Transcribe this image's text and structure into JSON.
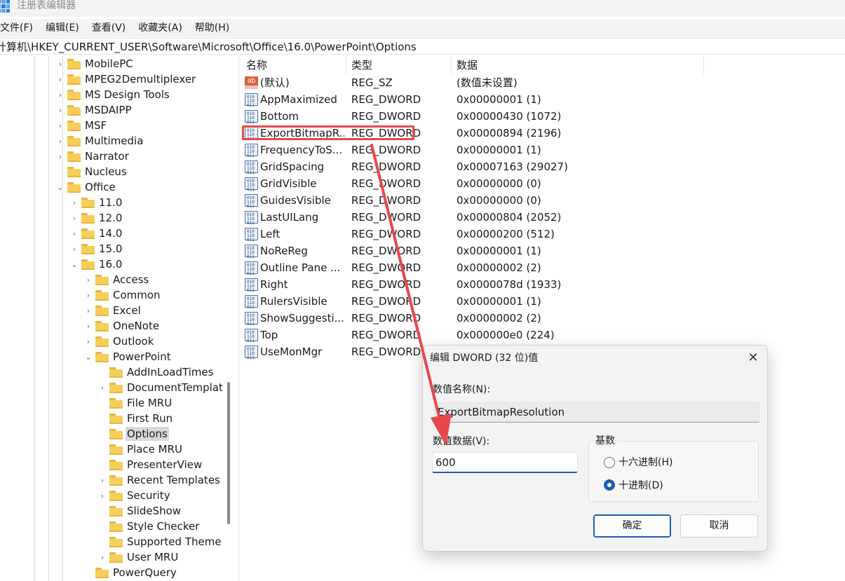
{
  "window": {
    "title": "注册表编辑器"
  },
  "menu": [
    "文件(F)",
    "编辑(E)",
    "查看(V)",
    "收藏夹(A)",
    "帮助(H)"
  ],
  "address": "计算机\\HKEY_CURRENT_USER\\Software\\Microsoft\\Office\\16.0\\PowerPoint\\Options",
  "tree": [
    {
      "label": "MobilePC",
      "caret": "›"
    },
    {
      "label": "MPEG2Demultiplexer",
      "caret": "›"
    },
    {
      "label": "MS Design Tools",
      "caret": "›"
    },
    {
      "label": "MSDAIPP",
      "caret": "›"
    },
    {
      "label": "MSF",
      "caret": "›"
    },
    {
      "label": "Multimedia",
      "caret": "›"
    },
    {
      "label": "Narrator",
      "caret": "›"
    },
    {
      "label": "Nucleus",
      "caret": ""
    },
    {
      "label": "Office",
      "caret": "⌄"
    },
    {
      "label": "11.0",
      "caret": "›"
    },
    {
      "label": "12.0",
      "caret": "›"
    },
    {
      "label": "14.0",
      "caret": "›"
    },
    {
      "label": "15.0",
      "caret": "›"
    },
    {
      "label": "16.0",
      "caret": "⌄"
    },
    {
      "label": "Access",
      "caret": "›"
    },
    {
      "label": "Common",
      "caret": "›"
    },
    {
      "label": "Excel",
      "caret": "›"
    },
    {
      "label": "OneNote",
      "caret": "›"
    },
    {
      "label": "Outlook",
      "caret": "›"
    },
    {
      "label": "PowerPoint",
      "caret": "⌄"
    },
    {
      "label": "AddInLoadTimes",
      "caret": ""
    },
    {
      "label": "DocumentTemplat",
      "caret": "›"
    },
    {
      "label": "File MRU",
      "caret": ""
    },
    {
      "label": "First Run",
      "caret": ""
    },
    {
      "label": "Options",
      "caret": "",
      "selected": true
    },
    {
      "label": "Place MRU",
      "caret": ""
    },
    {
      "label": "PresenterView",
      "caret": ""
    },
    {
      "label": "Recent Templates",
      "caret": "›"
    },
    {
      "label": "Security",
      "caret": "›"
    },
    {
      "label": "SlideShow",
      "caret": ""
    },
    {
      "label": "Style Checker",
      "caret": ""
    },
    {
      "label": "Supported Theme",
      "caret": ""
    },
    {
      "label": "User MRU",
      "caret": "›"
    },
    {
      "label": "PowerQuery",
      "caret": ""
    }
  ],
  "columns": {
    "name": "名称",
    "type": "类型",
    "data": "数据"
  },
  "values": [
    {
      "icon": "string",
      "name": "(默认)",
      "type": "REG_SZ",
      "data": "(数值未设置)"
    },
    {
      "icon": "dword",
      "name": "AppMaximized",
      "type": "REG_DWORD",
      "data": "0x00000001 (1)"
    },
    {
      "icon": "dword",
      "name": "Bottom",
      "type": "REG_DWORD",
      "data": "0x00000430 (1072)"
    },
    {
      "icon": "dword",
      "name": "ExportBitmapR...",
      "type": "REG_DWORD",
      "data": "0x00000894 (2196)"
    },
    {
      "icon": "dword",
      "name": "FrequencyToS...",
      "type": "REG_DWORD",
      "data": "0x00000001 (1)"
    },
    {
      "icon": "dword",
      "name": "GridSpacing",
      "type": "REG_DWORD",
      "data": "0x00007163 (29027)"
    },
    {
      "icon": "dword",
      "name": "GridVisible",
      "type": "REG_DWORD",
      "data": "0x00000000 (0)"
    },
    {
      "icon": "dword",
      "name": "GuidesVisible",
      "type": "REG_DWORD",
      "data": "0x00000000 (0)"
    },
    {
      "icon": "dword",
      "name": "LastUILang",
      "type": "REG_DWORD",
      "data": "0x00000804 (2052)"
    },
    {
      "icon": "dword",
      "name": "Left",
      "type": "REG_DWORD",
      "data": "0x00000200 (512)"
    },
    {
      "icon": "dword",
      "name": "NoReReg",
      "type": "REG_DWORD",
      "data": "0x00000001 (1)"
    },
    {
      "icon": "dword",
      "name": "Outline Pane ...",
      "type": "REG_DWORD",
      "data": "0x00000002 (2)"
    },
    {
      "icon": "dword",
      "name": "Right",
      "type": "REG_DWORD",
      "data": "0x0000078d (1933)"
    },
    {
      "icon": "dword",
      "name": "RulersVisible",
      "type": "REG_DWORD",
      "data": "0x00000001 (1)"
    },
    {
      "icon": "dword",
      "name": "ShowSuggesti...",
      "type": "REG_DWORD",
      "data": "0x00000002 (2)"
    },
    {
      "icon": "dword",
      "name": "Top",
      "type": "REG_DWORD",
      "data": "0x000000e0 (224)"
    },
    {
      "icon": "dword",
      "name": "UseMonMgr",
      "type": "REG_DWORD",
      "data": ""
    }
  ],
  "dialog": {
    "title": "编辑 DWORD (32 位)值",
    "close": "✕",
    "name_label": "数值名称(N):",
    "name_value": "ExportBitmapResolution",
    "data_label": "数值数据(V):",
    "data_value": "600",
    "base_label": "基数",
    "hex_label": "十六进制(H)",
    "dec_label": "十进制(D)",
    "base_selected": "decimal",
    "ok": "确定",
    "cancel": "取消"
  },
  "colors": {
    "annotation": "#e8474c",
    "accent": "#1c5fb4",
    "folder": "#f6cf5a"
  }
}
